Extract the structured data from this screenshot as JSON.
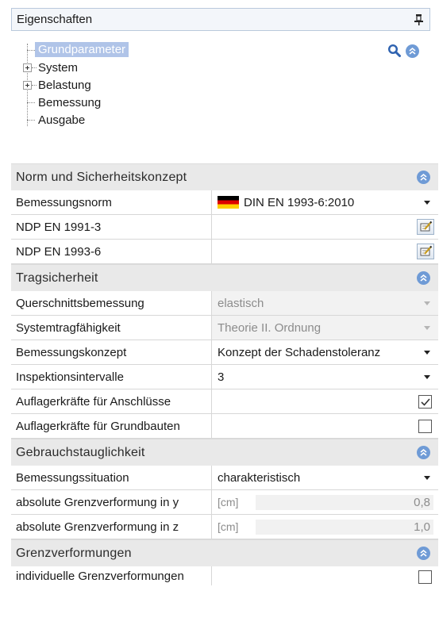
{
  "panel": {
    "title": "Eigenschaften"
  },
  "tree": {
    "items": [
      {
        "label": "Grundparameter",
        "selected": true,
        "expandable": false
      },
      {
        "label": "System",
        "selected": false,
        "expandable": true
      },
      {
        "label": "Belastung",
        "selected": false,
        "expandable": true
      },
      {
        "label": "Bemessung",
        "selected": false,
        "expandable": false
      },
      {
        "label": "Ausgabe",
        "selected": false,
        "expandable": false
      }
    ]
  },
  "sections": [
    {
      "title": "Norm und Sicherheitskonzept",
      "rows": [
        {
          "label": "Bemessungsnorm",
          "value": "DIN EN 1993-6:2010",
          "type": "dropdown",
          "icon": "german-flag-icon"
        },
        {
          "label": "NDP EN 1991-3",
          "value": "",
          "type": "edit"
        },
        {
          "label": "NDP EN 1993-6",
          "value": "",
          "type": "edit"
        }
      ]
    },
    {
      "title": "Tragsicherheit",
      "rows": [
        {
          "label": "Querschnittsbemessung",
          "value": "elastisch",
          "type": "dropdown-disabled"
        },
        {
          "label": "Systemtragfähigkeit",
          "value": "Theorie II. Ordnung",
          "type": "dropdown-disabled"
        },
        {
          "label": "Bemessungskonzept",
          "value": "Konzept der Schadenstoleranz",
          "type": "dropdown"
        },
        {
          "label": "Inspektionsintervalle",
          "value": "3",
          "type": "dropdown"
        },
        {
          "label": "Auflagerkräfte für Anschlüsse",
          "checked": true,
          "type": "checkbox"
        },
        {
          "label": "Auflagerkräfte für Grundbauten",
          "checked": false,
          "type": "checkbox"
        }
      ]
    },
    {
      "title": "Gebrauchstauglichkeit",
      "rows": [
        {
          "label": "Bemessungssituation",
          "value": "charakteristisch",
          "type": "dropdown"
        },
        {
          "label": "absolute Grenzverformung in y",
          "unit": "[cm]",
          "value": "0,8",
          "type": "numeric"
        },
        {
          "label": "absolute Grenzverformung in z",
          "unit": "[cm]",
          "value": "1,0",
          "type": "numeric"
        }
      ]
    },
    {
      "title": "Grenzverformungen",
      "rows": [
        {
          "label": "individuelle Grenzverformungen",
          "checked": false,
          "type": "checkbox"
        }
      ]
    }
  ],
  "colors": {
    "accent": "#6f9bd6",
    "selection": "#b0c4e8",
    "section_bg": "#e9e9e9"
  }
}
